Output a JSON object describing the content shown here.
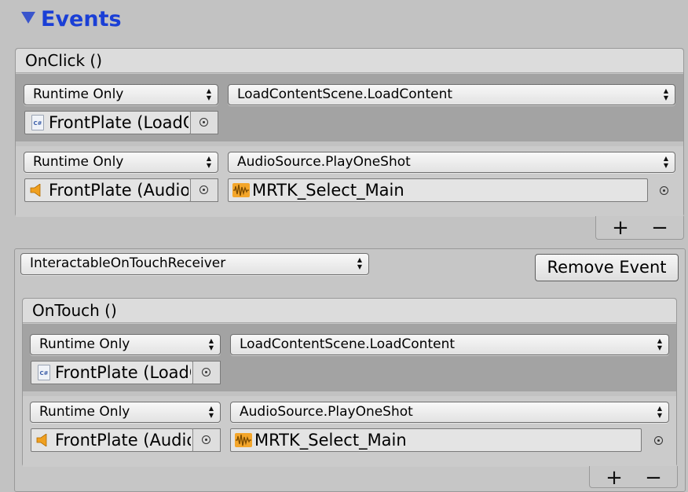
{
  "events": {
    "title": "Events",
    "onclick": {
      "header": "OnClick ()",
      "entries": [
        {
          "mode": "Runtime Only",
          "function": "LoadContentScene.LoadContent",
          "target": "FrontPlate (LoadContentScene)",
          "target_icon": "csharp-script-icon"
        },
        {
          "mode": "Runtime Only",
          "function": "AudioSource.PlayOneShot",
          "target": "FrontPlate (AudioSource)",
          "target_icon": "speaker-icon",
          "argument": "MRTK_Select_Main",
          "argument_icon": "audioclip-icon"
        }
      ],
      "add_label": "+",
      "remove_label": "−"
    },
    "receiver": {
      "selected": "InteractableOnTouchReceiver",
      "remove_event_label": "Remove Event",
      "ontouch": {
        "header": "OnTouch ()",
        "entries": [
          {
            "mode": "Runtime Only",
            "function": "LoadContentScene.LoadContent",
            "target": "FrontPlate (LoadContentScene)",
            "target_icon": "csharp-script-icon"
          },
          {
            "mode": "Runtime Only",
            "function": "AudioSource.PlayOneShot",
            "target": "FrontPlate (AudioSource)",
            "target_icon": "speaker-icon",
            "argument": "MRTK_Select_Main",
            "argument_icon": "audioclip-icon"
          }
        ],
        "add_label": "+",
        "remove_label": "−"
      }
    }
  },
  "colors": {
    "title": "#1a3fd6",
    "foldout_arrow": "#3a55cc",
    "selected_row": "#a3a3a3",
    "panel": "#c8c8c8",
    "speaker_icon": "#f0a020"
  }
}
